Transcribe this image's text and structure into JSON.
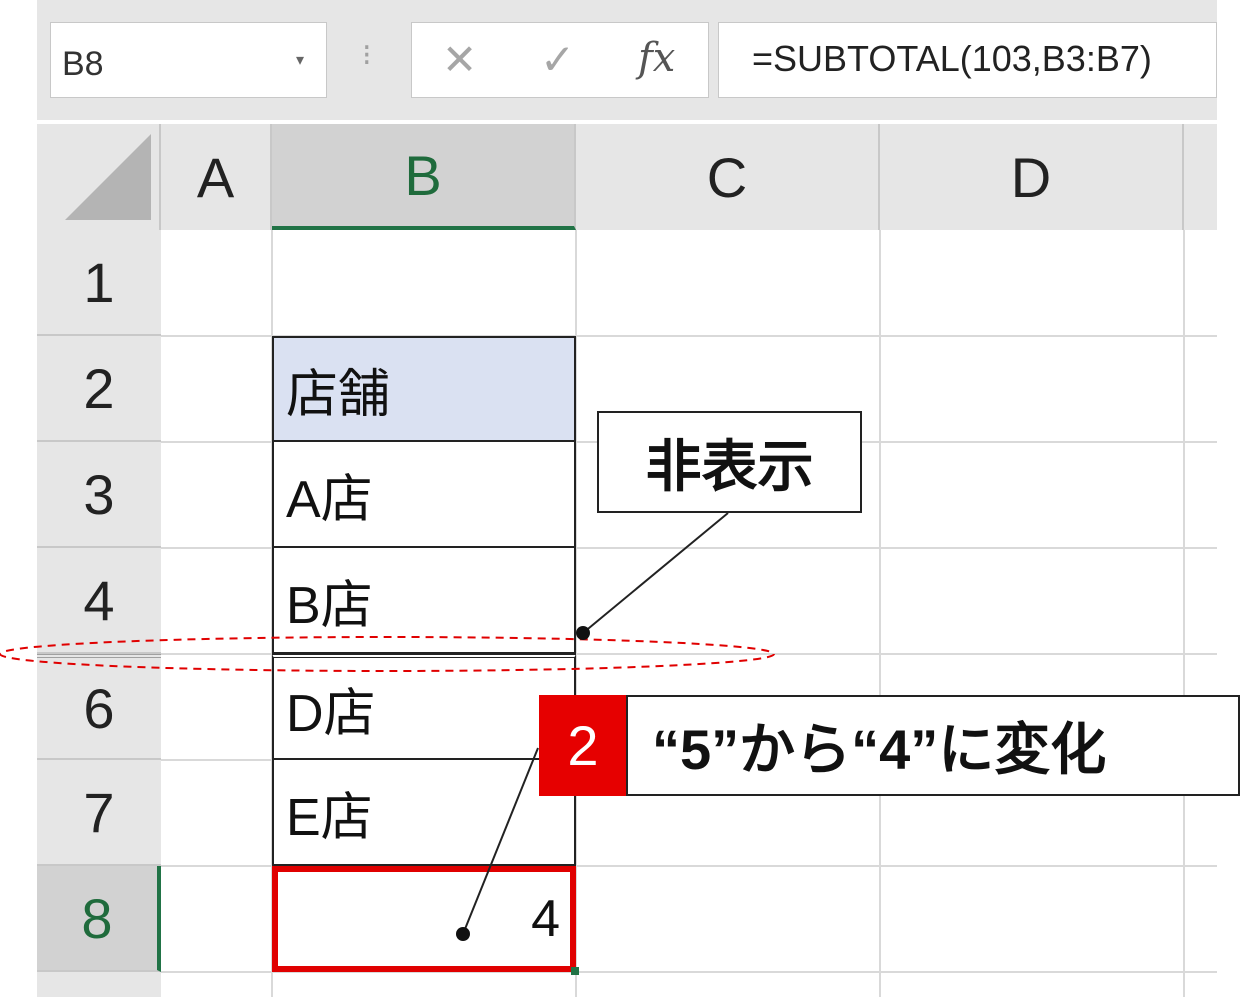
{
  "formula_bar": {
    "name_box": "B8",
    "dropdown_glyph": "▾",
    "grip_glyph": "⁝",
    "cancel_glyph": "✕",
    "enter_glyph": "✓",
    "fx_glyph": "fx",
    "formula": "=SUBTOTAL(103,B3:B7)"
  },
  "columns": [
    "A",
    "B",
    "C",
    "D"
  ],
  "rows": [
    "1",
    "2",
    "3",
    "4",
    "6",
    "7",
    "8"
  ],
  "cells": {
    "B2": "店舗",
    "B3": "A店",
    "B4": "B店",
    "B6": "D店",
    "B7": "E店",
    "B8": "4"
  },
  "annotations": {
    "hidden_label": "非表示",
    "step_number": "2",
    "change_label": "“5”から“4”に変化"
  },
  "colors": {
    "selected_accent": "#217346",
    "highlight_red": "#e00000",
    "header_fill": "#dae1f2"
  }
}
